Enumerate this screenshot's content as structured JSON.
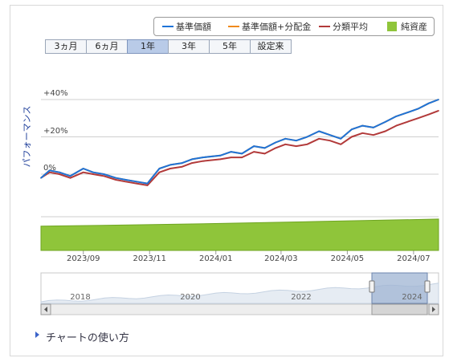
{
  "legend": [
    {
      "label": "基準価額",
      "color": "#1e73d8",
      "kind": "line"
    },
    {
      "label": "基準価額+分配金",
      "color": "#f08a1c",
      "kind": "line"
    },
    {
      "label": "分類平均",
      "color": "#b23a3a",
      "kind": "line"
    },
    {
      "label": "純資産",
      "color": "#8fc53a",
      "kind": "box"
    }
  ],
  "range_buttons": [
    "3ヵ月",
    "6ヵ月",
    "1年",
    "3年",
    "5年",
    "設定来"
  ],
  "active_range": "1年",
  "chart_data": {
    "type": "line",
    "ylabel": "パフォーマンス",
    "y_ticks": [
      "+40%",
      "+20%",
      "0%"
    ],
    "ylim": [
      -8,
      45
    ],
    "x_ticks": [
      "2023/09",
      "2023/11",
      "2024/01",
      "2024/03",
      "2024/05",
      "2024/07"
    ],
    "x_range": [
      "2023-07-24",
      "2024-07-24"
    ],
    "series": [
      {
        "name": "基準価額",
        "color": "#1e73d8",
        "x": [
          "2023-07-24",
          "2023-08-01",
          "2023-08-10",
          "2023-08-20",
          "2023-09-01",
          "2023-09-10",
          "2023-09-20",
          "2023-10-01",
          "2023-10-10",
          "2023-10-20",
          "2023-10-30",
          "2023-11-10",
          "2023-11-20",
          "2023-12-01",
          "2023-12-10",
          "2023-12-20",
          "2024-01-05",
          "2024-01-15",
          "2024-01-25",
          "2024-02-05",
          "2024-02-15",
          "2024-02-25",
          "2024-03-05",
          "2024-03-15",
          "2024-03-25",
          "2024-04-05",
          "2024-04-15",
          "2024-04-25",
          "2024-05-05",
          "2024-05-15",
          "2024-05-25",
          "2024-06-05",
          "2024-06-15",
          "2024-06-25",
          "2024-07-05",
          "2024-07-15",
          "2024-07-24"
        ],
        "values": [
          -2,
          2,
          1,
          -1,
          3,
          1,
          0,
          -2,
          -3,
          -4,
          -5,
          3,
          5,
          6,
          8,
          9,
          10,
          12,
          11,
          15,
          14,
          17,
          19,
          18,
          20,
          23,
          21,
          19,
          24,
          26,
          25,
          28,
          31,
          33,
          35,
          38,
          40
        ]
      },
      {
        "name": "基準価額+分配金",
        "color": "#f08a1c",
        "x": [
          "2023-07-24",
          "2023-08-01",
          "2023-08-10",
          "2023-08-20",
          "2023-09-01",
          "2023-09-10",
          "2023-09-20",
          "2023-10-01",
          "2023-10-10",
          "2023-10-20",
          "2023-10-30",
          "2023-11-10",
          "2023-11-20",
          "2023-12-01",
          "2023-12-10",
          "2023-12-20",
          "2024-01-05",
          "2024-01-15",
          "2024-01-25",
          "2024-02-05",
          "2024-02-15",
          "2024-02-25",
          "2024-03-05",
          "2024-03-15",
          "2024-03-25",
          "2024-04-05",
          "2024-04-15",
          "2024-04-25",
          "2024-05-05",
          "2024-05-15",
          "2024-05-25",
          "2024-06-05",
          "2024-06-15",
          "2024-06-25",
          "2024-07-05",
          "2024-07-15",
          "2024-07-24"
        ],
        "values": [
          -2,
          2,
          1,
          -1,
          3,
          1,
          0,
          -2,
          -3,
          -4,
          -5,
          3,
          5,
          6,
          8,
          9,
          10,
          12,
          11,
          15,
          14,
          17,
          19,
          18,
          20,
          23,
          21,
          19,
          24,
          26,
          25,
          28,
          31,
          33,
          35,
          38,
          40
        ]
      },
      {
        "name": "分類平均",
        "color": "#b23a3a",
        "x": [
          "2023-07-24",
          "2023-08-01",
          "2023-08-10",
          "2023-08-20",
          "2023-09-01",
          "2023-09-10",
          "2023-09-20",
          "2023-10-01",
          "2023-10-10",
          "2023-10-20",
          "2023-10-30",
          "2023-11-10",
          "2023-11-20",
          "2023-12-01",
          "2023-12-10",
          "2023-12-20",
          "2024-01-05",
          "2024-01-15",
          "2024-01-25",
          "2024-02-05",
          "2024-02-15",
          "2024-02-25",
          "2024-03-05",
          "2024-03-15",
          "2024-03-25",
          "2024-04-05",
          "2024-04-15",
          "2024-04-25",
          "2024-05-05",
          "2024-05-15",
          "2024-05-25",
          "2024-06-05",
          "2024-06-15",
          "2024-06-25",
          "2024-07-05",
          "2024-07-15",
          "2024-07-24"
        ],
        "values": [
          -2,
          1,
          0,
          -2,
          1,
          0,
          -1,
          -3,
          -4,
          -5,
          -6,
          1,
          3,
          4,
          6,
          7,
          8,
          9,
          9,
          12,
          11,
          14,
          16,
          15,
          16,
          19,
          18,
          16,
          20,
          22,
          21,
          23,
          26,
          28,
          30,
          32,
          34
        ]
      },
      {
        "name": "純資産",
        "color": "#8fc53a",
        "kind": "area",
        "x": [
          "2023-07-24",
          "2023-10-01",
          "2024-01-05",
          "2024-04-05",
          "2024-07-24"
        ],
        "values": [
          0.72,
          0.75,
          0.8,
          0.86,
          0.93
        ]
      }
    ]
  },
  "navigator": {
    "year_labels": [
      "2018",
      "2020",
      "2022",
      "2024"
    ]
  },
  "help_link": "チャートの使い方"
}
